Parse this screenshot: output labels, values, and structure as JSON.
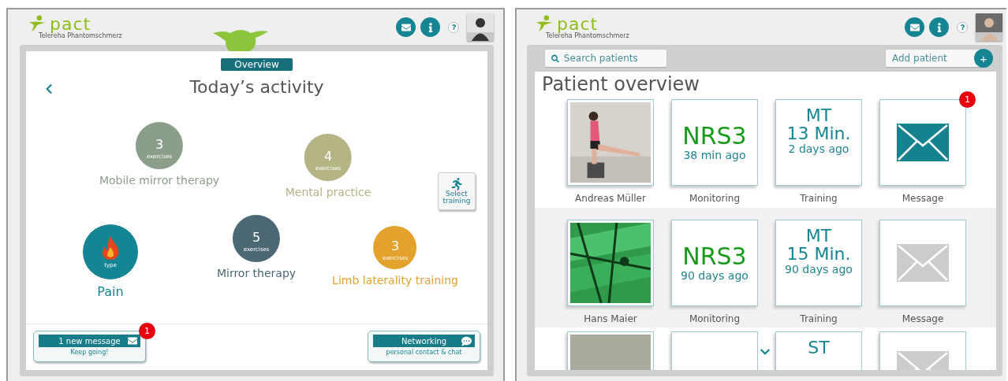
{
  "left": {
    "logo": {
      "name": "pact",
      "tagline": "Telereha Phantomschmerz"
    },
    "overview_label": "Overview",
    "title": "Today’s activity",
    "activities": [
      {
        "kind": "count",
        "label": "Mobile mirror therapy",
        "value": "3",
        "unit": "exercises",
        "color": "#8a9e8a"
      },
      {
        "kind": "count",
        "label": "Mental practice",
        "value": "4",
        "unit": "exercises",
        "color": "#b4b485"
      },
      {
        "kind": "icon",
        "label": "Pain",
        "unit": "type",
        "color": "#148594"
      },
      {
        "kind": "count",
        "label": "Mirror therapy",
        "value": "5",
        "unit": "exercises",
        "color": "#4b6874"
      },
      {
        "kind": "count",
        "label": "Limb laterality training",
        "value": "3",
        "unit": "exercises",
        "color": "#e2a22c"
      }
    ],
    "select_training": "Select training",
    "message_button": {
      "label": "1 new message",
      "subtitle": "Keep going!",
      "badge": "1"
    },
    "networking_button": {
      "label": "Networking",
      "subtitle": "personal contact & chat"
    }
  },
  "right": {
    "logo": {
      "name": "pact",
      "tagline": "Telereha Phantomschmerz"
    },
    "search": {
      "placeholder": "Search patients"
    },
    "add_patient": {
      "placeholder": "Add patient",
      "button": "+"
    },
    "title": "Patient overview",
    "patients": [
      {
        "name": "Andreas Müller",
        "monitoring": {
          "score": "NRS3",
          "time": "38 min ago",
          "label": "Monitoring"
        },
        "training": {
          "code": "MT",
          "duration": "13 Min.",
          "time": "2 days ago",
          "label": "Training"
        },
        "message": {
          "unread": true,
          "badge": "1",
          "label": "Message"
        }
      },
      {
        "name": "Hans Maier",
        "monitoring": {
          "score": "NRS3",
          "time": "90 days ago",
          "label": "Monitoring"
        },
        "training": {
          "code": "MT",
          "duration": "15 Min.",
          "time": "90 days ago",
          "label": "Training"
        },
        "message": {
          "unread": false,
          "label": "Message"
        }
      },
      {
        "training": {
          "code": "ST"
        },
        "message": {
          "unread": false
        }
      }
    ]
  }
}
